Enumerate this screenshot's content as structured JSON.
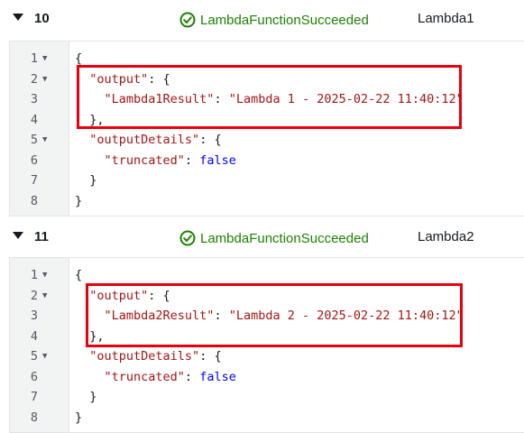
{
  "events": [
    {
      "id": "10",
      "status": "LambdaFunctionSucceeded",
      "resource": "Lambda1",
      "lines": [
        {
          "n": "1",
          "fold": true,
          "indent": 0,
          "parts": [
            {
              "t": "p",
              "v": "{"
            }
          ]
        },
        {
          "n": "2",
          "fold": true,
          "indent": 1,
          "parts": [
            {
              "t": "k",
              "v": "\"output\""
            },
            {
              "t": "p",
              "v": ": {"
            }
          ]
        },
        {
          "n": "3",
          "fold": false,
          "indent": 2,
          "parts": [
            {
              "t": "k",
              "v": "\"Lambda1Result\""
            },
            {
              "t": "p",
              "v": ": "
            },
            {
              "t": "s",
              "v": "\"Lambda 1 - 2025-02-22 11:40:12\""
            }
          ]
        },
        {
          "n": "4",
          "fold": false,
          "indent": 1,
          "parts": [
            {
              "t": "p",
              "v": "},"
            }
          ]
        },
        {
          "n": "5",
          "fold": true,
          "indent": 1,
          "parts": [
            {
              "t": "k",
              "v": "\"outputDetails\""
            },
            {
              "t": "p",
              "v": ": {"
            }
          ]
        },
        {
          "n": "6",
          "fold": false,
          "indent": 2,
          "parts": [
            {
              "t": "k",
              "v": "\"truncated\""
            },
            {
              "t": "p",
              "v": ": "
            },
            {
              "t": "b",
              "v": "false"
            }
          ]
        },
        {
          "n": "7",
          "fold": false,
          "indent": 1,
          "parts": [
            {
              "t": "p",
              "v": "}"
            }
          ]
        },
        {
          "n": "8",
          "fold": false,
          "indent": 0,
          "parts": [
            {
              "t": "p",
              "v": "}"
            }
          ]
        }
      ]
    },
    {
      "id": "11",
      "status": "LambdaFunctionSucceeded",
      "resource": "Lambda2",
      "lines": [
        {
          "n": "1",
          "fold": true,
          "indent": 0,
          "parts": [
            {
              "t": "p",
              "v": "{"
            }
          ]
        },
        {
          "n": "2",
          "fold": true,
          "indent": 1,
          "parts": [
            {
              "t": "k",
              "v": "\"output\""
            },
            {
              "t": "p",
              "v": ": {"
            }
          ]
        },
        {
          "n": "3",
          "fold": false,
          "indent": 2,
          "parts": [
            {
              "t": "k",
              "v": "\"Lambda2Result\""
            },
            {
              "t": "p",
              "v": ": "
            },
            {
              "t": "s",
              "v": "\"Lambda 2 - 2025-02-22 11:40:12\""
            }
          ]
        },
        {
          "n": "4",
          "fold": false,
          "indent": 1,
          "parts": [
            {
              "t": "p",
              "v": "},"
            }
          ]
        },
        {
          "n": "5",
          "fold": true,
          "indent": 1,
          "parts": [
            {
              "t": "k",
              "v": "\"outputDetails\""
            },
            {
              "t": "p",
              "v": ": {"
            }
          ]
        },
        {
          "n": "6",
          "fold": false,
          "indent": 2,
          "parts": [
            {
              "t": "k",
              "v": "\"truncated\""
            },
            {
              "t": "p",
              "v": ": "
            },
            {
              "t": "b",
              "v": "false"
            }
          ]
        },
        {
          "n": "7",
          "fold": false,
          "indent": 1,
          "parts": [
            {
              "t": "p",
              "v": "}"
            }
          ]
        },
        {
          "n": "8",
          "fold": false,
          "indent": 0,
          "parts": [
            {
              "t": "p",
              "v": "}"
            }
          ]
        }
      ]
    }
  ],
  "colors": {
    "success": "#1d8102",
    "json_key": "#a31515",
    "json_bool": "#0000ff",
    "annotation_box": "#e8000d"
  },
  "icons": {
    "status": "check-circle-icon",
    "expand": "caret-down-icon",
    "fold": "fold-arrow-icon"
  }
}
